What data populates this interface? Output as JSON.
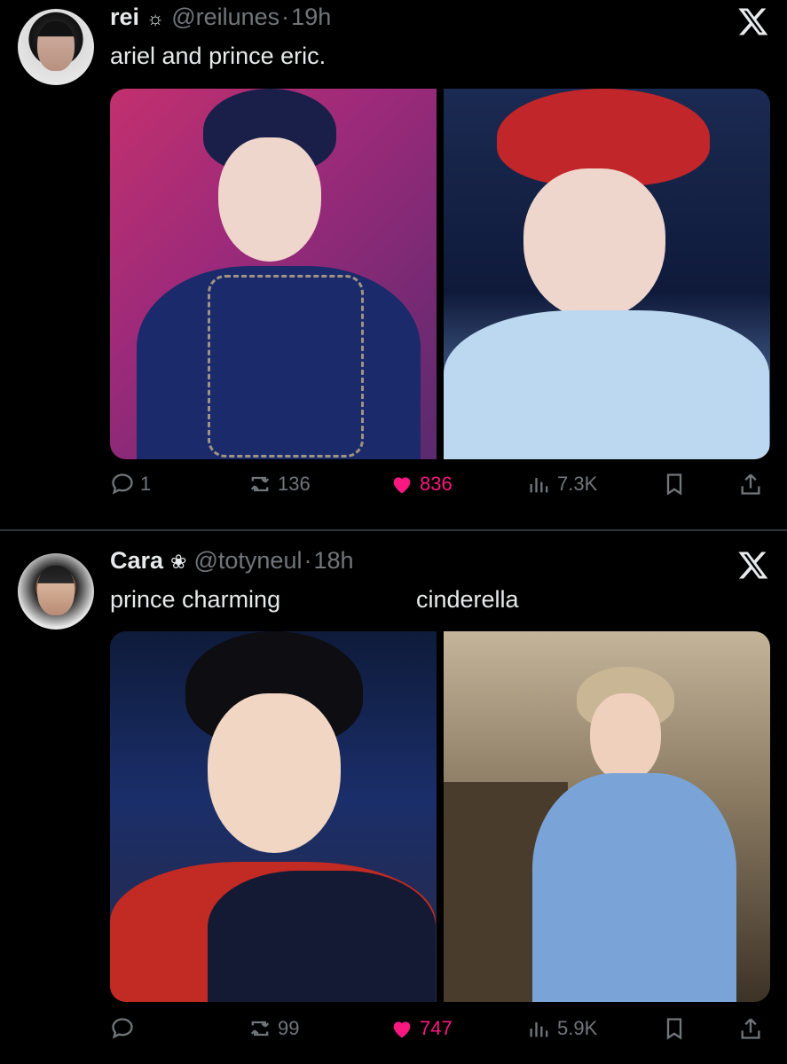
{
  "tweets": [
    {
      "name": "rei",
      "flower": "☼",
      "handle": "@reilunes",
      "dot": "·",
      "time": "19h",
      "text": "ariel and prince eric.",
      "replies": "1",
      "reposts": "136",
      "likes": "836",
      "views": "7.3K"
    },
    {
      "name": "Cara",
      "flower": "❀",
      "handle": "@totyneul",
      "dot": "·",
      "time": "18h",
      "text": "prince charming",
      "text2": "cinderella",
      "replies": "",
      "reposts": "99",
      "likes": "747",
      "views": "5.9K"
    }
  ],
  "colors": {
    "accent_like": "#f91880",
    "muted": "#71767b",
    "text": "#e7e9ea"
  },
  "icons": [
    "reply-icon",
    "repost-icon",
    "like-icon",
    "views-icon",
    "bookmark-icon",
    "share-icon",
    "x-logo-icon"
  ]
}
